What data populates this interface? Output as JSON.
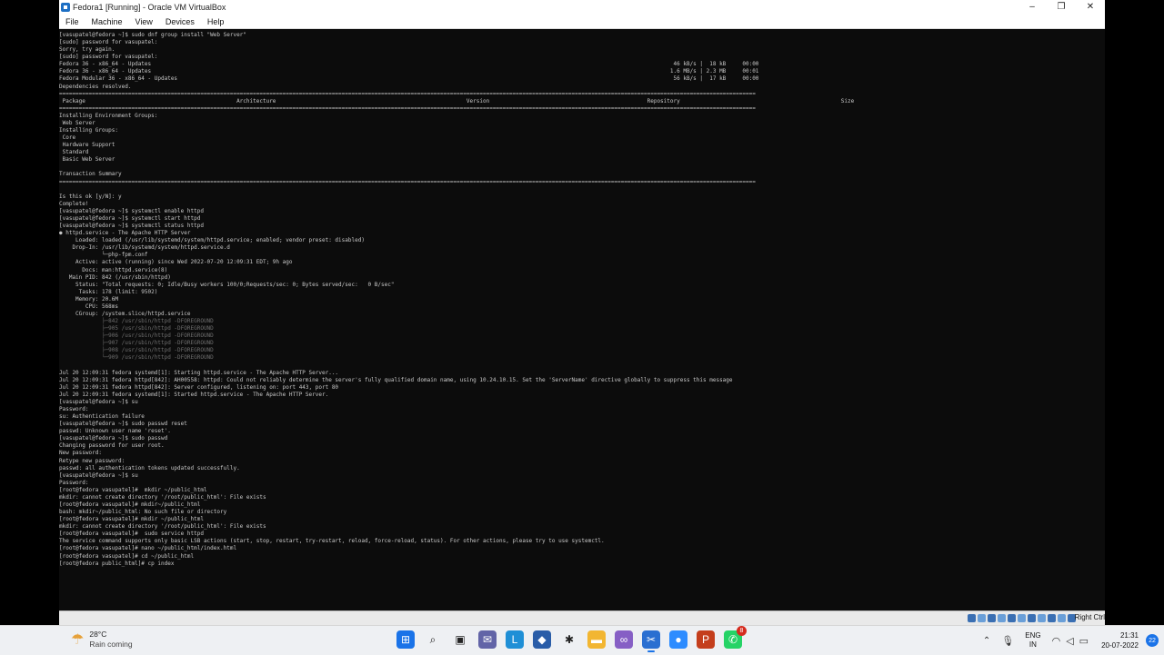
{
  "window": {
    "title": "Fedora1 [Running] - Oracle VM VirtualBox",
    "controls": {
      "minimize": "–",
      "restore": "❐",
      "close": "✕"
    }
  },
  "menu": [
    "File",
    "Machine",
    "View",
    "Devices",
    "Help"
  ],
  "terminal": {
    "lines": [
      {
        "t": "[vasupatel@fedora ~]$ sudo dnf group install \"Web Server\""
      },
      {
        "t": "[sudo] password for vasupatel:"
      },
      {
        "t": "Sorry, try again."
      },
      {
        "t": "[sudo] password for vasupatel:"
      },
      {
        "t": "Fedora 36 - x86_64 - Updates                                                                                                                                                               46 kB/s |  18 kB     00:00"
      },
      {
        "t": "Fedora 36 - x86_64 - Updates                                                                                                                                                              1.6 MB/s | 2.3 MB     00:01"
      },
      {
        "t": "Fedora Modular 36 - x86_64 - Updates                                                                                                                                                       56 kB/s |  17 kB     00:00"
      },
      {
        "t": "Dependencies resolved."
      },
      {
        "t": "===================================================================================================================================================================================================================="
      },
      {
        "t": " Package                                              Architecture                                                          Version                                                Repository                                                 Size"
      },
      {
        "t": "===================================================================================================================================================================================================================="
      },
      {
        "t": "Installing Environment Groups:"
      },
      {
        "t": " Web Server"
      },
      {
        "t": "Installing Groups:"
      },
      {
        "t": " Core"
      },
      {
        "t": " Hardware Support"
      },
      {
        "t": " Standard"
      },
      {
        "t": " Basic Web Server"
      },
      {
        "t": ""
      },
      {
        "t": "Transaction Summary"
      },
      {
        "t": "===================================================================================================================================================================================================================="
      },
      {
        "t": ""
      },
      {
        "t": "Is this ok [y/N]: y"
      },
      {
        "t": "Complete!"
      },
      {
        "t": "[vasupatel@fedora ~]$ systemctl enable httpd"
      },
      {
        "t": "[vasupatel@fedora ~]$ systemctl start httpd"
      },
      {
        "t": "[vasupatel@fedora ~]$ systemctl status httpd"
      },
      {
        "t": "● httpd.service - The Apache HTTP Server"
      },
      {
        "t": "     Loaded: loaded (/usr/lib/systemd/system/httpd.service; enabled; vendor preset: disabled)"
      },
      {
        "t": "    Drop-In: /usr/lib/systemd/system/httpd.service.d"
      },
      {
        "t": "             └─php-fpm.conf"
      },
      {
        "t": "     Active: active (running) since Wed 2022-07-20 12:09:31 EDT; 9h ago"
      },
      {
        "t": "       Docs: man:httpd.service(8)"
      },
      {
        "t": "   Main PID: 842 (/usr/sbin/httpd)"
      },
      {
        "t": "     Status: \"Total requests: 0; Idle/Busy workers 100/0;Requests/sec: 0; Bytes served/sec:   0 B/sec\""
      },
      {
        "t": "      Tasks: 178 (limit: 9502)"
      },
      {
        "t": "     Memory: 20.6M"
      },
      {
        "t": "        CPU: 568ms"
      },
      {
        "t": "     CGroup: /system.slice/httpd.service"
      },
      {
        "t": "             ├─842 /usr/sbin/httpd -DFOREGROUND",
        "g": true
      },
      {
        "t": "             ├─905 /usr/sbin/httpd -DFOREGROUND",
        "g": true
      },
      {
        "t": "             ├─906 /usr/sbin/httpd -DFOREGROUND",
        "g": true
      },
      {
        "t": "             ├─907 /usr/sbin/httpd -DFOREGROUND",
        "g": true
      },
      {
        "t": "             ├─908 /usr/sbin/httpd -DFOREGROUND",
        "g": true
      },
      {
        "t": "             └─909 /usr/sbin/httpd -DFOREGROUND",
        "g": true
      },
      {
        "t": ""
      },
      {
        "t": "Jul 20 12:09:31 fedora systemd[1]: Starting httpd.service - The Apache HTTP Server..."
      },
      {
        "t": "Jul 20 12:09:31 fedora httpd[842]: AH00558: httpd: Could not reliably determine the server's fully qualified domain name, using 10.24.10.15. Set the 'ServerName' directive globally to suppress this message"
      },
      {
        "t": "Jul 20 12:09:31 fedora httpd[842]: Server configured, listening on: port 443, port 80"
      },
      {
        "t": "Jul 20 12:09:31 fedora systemd[1]: Started httpd.service - The Apache HTTP Server."
      },
      {
        "t": "[vasupatel@fedora ~]$ su"
      },
      {
        "t": "Password:"
      },
      {
        "t": "su: Authentication failure"
      },
      {
        "t": "[vasupatel@fedora ~]$ sudo passwd reset"
      },
      {
        "t": "passwd: Unknown user name 'reset'."
      },
      {
        "t": "[vasupatel@fedora ~]$ sudo passwd"
      },
      {
        "t": "Changing password for user root."
      },
      {
        "t": "New password:"
      },
      {
        "t": "Retype new password:"
      },
      {
        "t": "passwd: all authentication tokens updated successfully."
      },
      {
        "t": "[vasupatel@fedora ~]$ su"
      },
      {
        "t": "Password:"
      },
      {
        "t": "[root@fedora vasupatel]#  mkdir ~/public_html"
      },
      {
        "t": "mkdir: cannot create directory '/root/public_html': File exists"
      },
      {
        "t": "[root@fedora vasupatel]# mkdir~/public_html"
      },
      {
        "t": "bash: mkdir~/public_html: No such file or directory"
      },
      {
        "t": "[root@fedora vasupatel]# mkdir ~/public_html"
      },
      {
        "t": "mkdir: cannot create directory '/root/public_html': File exists"
      },
      {
        "t": "[root@fedora vasupatel]#  sudo service httpd"
      },
      {
        "t": "The service command supports only basic LSB actions (start, stop, restart, try-restart, reload, force-reload, status). For other actions, please try to use systemctl."
      },
      {
        "t": "[root@fedora vasupatel]# nano ~/public_html/index.html"
      },
      {
        "t": "[root@fedora vasupatel]# cd ~/public_html"
      },
      {
        "t": "[root@fedora public_html]# cp index"
      }
    ]
  },
  "vbox_status": {
    "host_key": "Right Ctrl"
  },
  "taskbar": {
    "weather": {
      "temp": "28°C",
      "desc": "Rain coming"
    },
    "apps": [
      {
        "name": "start-button",
        "icon": "windows-icon",
        "color": "#1a73e8",
        "glyph": "⊞"
      },
      {
        "name": "search-button",
        "icon": "search-icon",
        "color": "#eef0f3",
        "glyph": "⌕",
        "dark": true
      },
      {
        "name": "task-view-button",
        "icon": "task-view-icon",
        "color": "#eef0f3",
        "glyph": "▣",
        "dark": true
      },
      {
        "name": "chat-button",
        "icon": "chat-icon",
        "color": "#6264a7",
        "glyph": "✉"
      },
      {
        "name": "lens-app",
        "icon": "l-icon",
        "color": "#1f8fd6",
        "glyph": "L"
      },
      {
        "name": "virtualbox-app",
        "icon": "cube-icon",
        "color": "#2a5da8",
        "glyph": "◆"
      },
      {
        "name": "slack-app",
        "icon": "slack-icon",
        "color": "#eef0f3",
        "glyph": "✱",
        "dark": true
      },
      {
        "name": "file-explorer-app",
        "icon": "folder-icon",
        "color": "#f2b632",
        "glyph": "▬"
      },
      {
        "name": "visual-studio-app",
        "icon": "vs-icon",
        "color": "#865fc5",
        "glyph": "∞"
      },
      {
        "name": "snipping-tool-app",
        "icon": "snip-icon",
        "color": "#2a6fd1",
        "glyph": "✂",
        "active": true
      },
      {
        "name": "zoom-app",
        "icon": "video-icon",
        "color": "#2d8cff",
        "glyph": "●"
      },
      {
        "name": "powerpoint-app",
        "icon": "ppt-icon",
        "color": "#c43e1c",
        "glyph": "P"
      },
      {
        "name": "whatsapp-app",
        "icon": "whatsapp-icon",
        "color": "#25d366",
        "glyph": "✆",
        "badge": "8"
      }
    ],
    "tray": {
      "lang_top": "ENG",
      "lang_bottom": "IN",
      "time": "21:31",
      "date": "20-07-2022",
      "notifications": "22"
    }
  }
}
